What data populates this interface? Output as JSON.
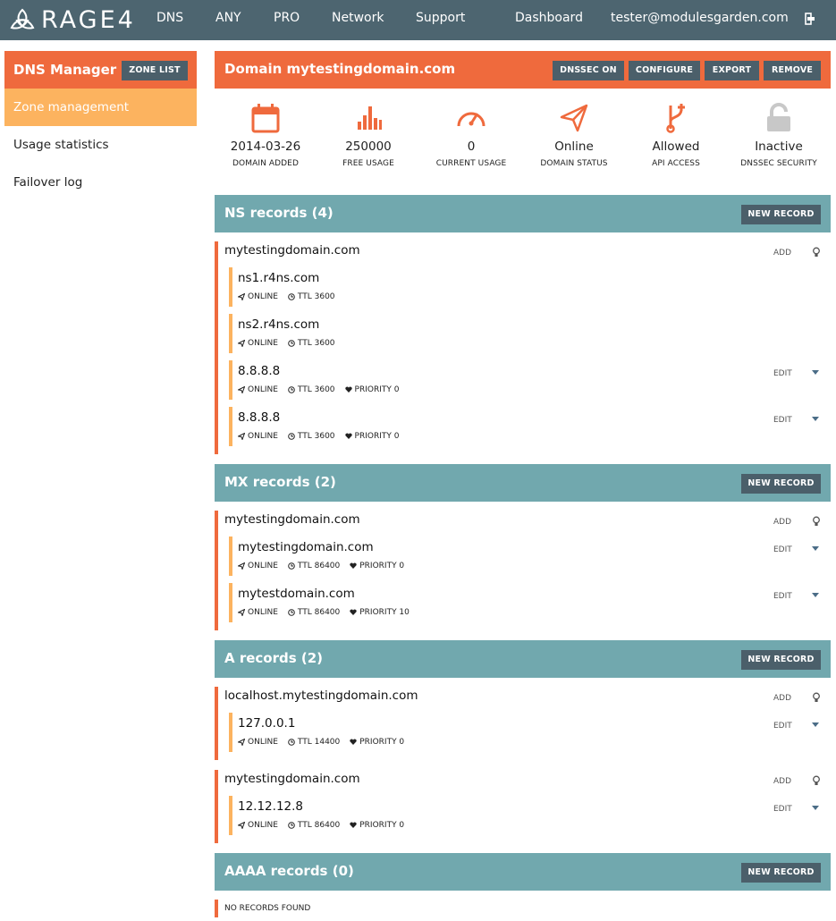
{
  "topbar": {
    "logo_text": "RAGE4",
    "nav": [
      "DNS",
      "ANY",
      "PRO",
      "Network",
      "Support"
    ],
    "dashboard": "Dashboard",
    "user_email": "tester@modulesgarden.com",
    "colors": {
      "background": "#4d6570"
    }
  },
  "sidebar": {
    "title": "DNS Manager",
    "zone_list_button": "ZONE LIST",
    "items": [
      {
        "label": "Zone management",
        "active": true
      },
      {
        "label": "Usage statistics",
        "active": false
      },
      {
        "label": "Failover log",
        "active": false
      }
    ]
  },
  "domain": {
    "title": "Domain mytestingdomain.com",
    "buttons": [
      "DNSSEC ON",
      "CONFIGURE",
      "EXPORT",
      "REMOVE"
    ]
  },
  "stats": [
    {
      "icon": "calendar-icon",
      "value": "2014-03-26",
      "label": "DOMAIN ADDED"
    },
    {
      "icon": "bar-chart-icon",
      "value": "250000",
      "label": "FREE USAGE"
    },
    {
      "icon": "speedometer-icon",
      "value": "0",
      "label": "CURRENT USAGE"
    },
    {
      "icon": "paper-plane-icon",
      "value": "Online",
      "label": "DOMAIN STATUS"
    },
    {
      "icon": "git-branch-icon",
      "value": "Allowed",
      "label": "API ACCESS"
    },
    {
      "icon": "lock-icon",
      "value": "Inactive",
      "label": "DNSSEC SECURITY"
    }
  ],
  "labels": {
    "new_record": "NEW RECORD",
    "add": "ADD",
    "edit": "EDIT",
    "online": "ONLINE",
    "no_records": "NO RECORDS FOUND"
  },
  "sections": {
    "ns": {
      "title": "NS records (4)",
      "groups": [
        {
          "name": "mytestingdomain.com",
          "records": [
            {
              "value": "ns1.r4ns.com",
              "ttl": "TTL 3600"
            },
            {
              "value": "ns2.r4ns.com",
              "ttl": "TTL 3600"
            },
            {
              "value": "8.8.8.8",
              "ttl": "TTL 3600",
              "priority": "PRIORITY 0"
            },
            {
              "value": "8.8.8.8",
              "ttl": "TTL 3600",
              "priority": "PRIORITY 0"
            }
          ]
        }
      ]
    },
    "mx": {
      "title": "MX records (2)",
      "groups": [
        {
          "name": "mytestingdomain.com",
          "records": [
            {
              "value": "mytestingdomain.com",
              "ttl": "TTL 86400",
              "priority": "PRIORITY 0"
            },
            {
              "value": "mytestdomain.com",
              "ttl": "TTL 86400",
              "priority": "PRIORITY 10"
            }
          ]
        }
      ]
    },
    "a": {
      "title": "A records (2)",
      "groups": [
        {
          "name": "localhost.mytestingdomain.com",
          "records": [
            {
              "value": "127.0.0.1",
              "ttl": "TTL 14400",
              "priority": "PRIORITY 0"
            }
          ]
        },
        {
          "name": "mytestingdomain.com",
          "records": [
            {
              "value": "12.12.12.8",
              "ttl": "TTL 86400",
              "priority": "PRIORITY 0"
            }
          ]
        }
      ]
    },
    "aaaa": {
      "title": "AAAA records (0)"
    }
  },
  "colors": {
    "accent_orange": "#ef6a3d",
    "active_orange": "#fcb35f",
    "section_teal": "#71a8ae",
    "button_dark": "#4b5f6a"
  }
}
